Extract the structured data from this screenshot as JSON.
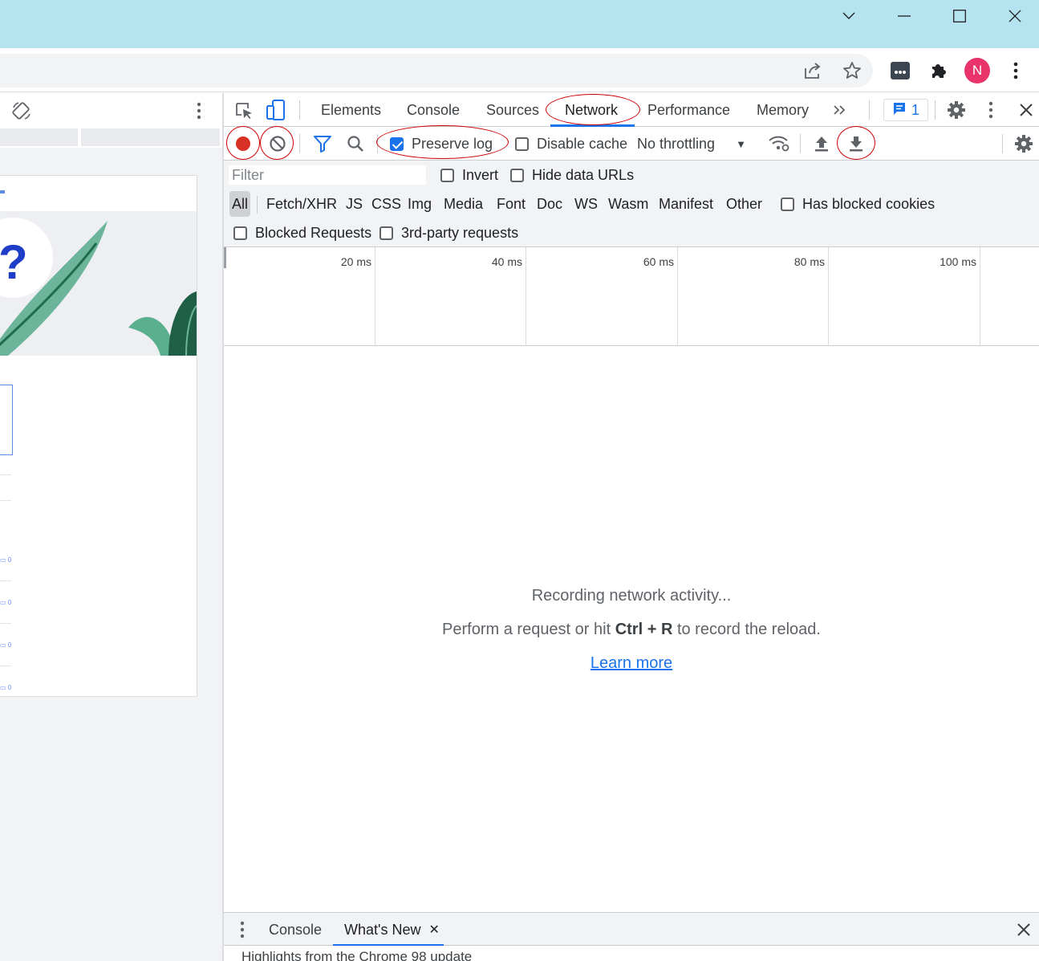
{
  "devtools": {
    "tabs": [
      "Elements",
      "Console",
      "Sources",
      "Network",
      "Performance",
      "Memory"
    ],
    "active_tab": "Network",
    "issues_count": "1"
  },
  "network_toolbar": {
    "preserve_log": "Preserve log",
    "disable_cache": "Disable cache",
    "throttling": "No throttling"
  },
  "filter": {
    "placeholder": "Filter",
    "invert": "Invert",
    "hide_data_urls": "Hide data URLs",
    "types": [
      "All",
      "Fetch/XHR",
      "JS",
      "CSS",
      "Img",
      "Media",
      "Font",
      "Doc",
      "WS",
      "Wasm",
      "Manifest",
      "Other"
    ],
    "has_blocked_cookies": "Has blocked cookies",
    "blocked_requests": "Blocked Requests",
    "third_party": "3rd-party requests"
  },
  "timeline": {
    "ticks": [
      "20 ms",
      "40 ms",
      "60 ms",
      "80 ms",
      "100 ms"
    ]
  },
  "empty_state": {
    "title": "Recording network activity...",
    "hint_prefix": "Perform a request or hit ",
    "hint_key": "Ctrl + R",
    "hint_suffix": " to record the reload.",
    "link": "Learn more"
  },
  "drawer": {
    "tabs": [
      "Console",
      "What's New"
    ],
    "body": "Highlights from the Chrome 98 update"
  },
  "browser": {
    "avatar_initial": "N"
  },
  "page_preview": {
    "chat_count": "0"
  },
  "colors": {
    "titlebar": "#b5e3f0",
    "accent": "#1a73e8",
    "record": "#d93025",
    "annotation": "#cc0000",
    "avatar": "#e8336b"
  }
}
